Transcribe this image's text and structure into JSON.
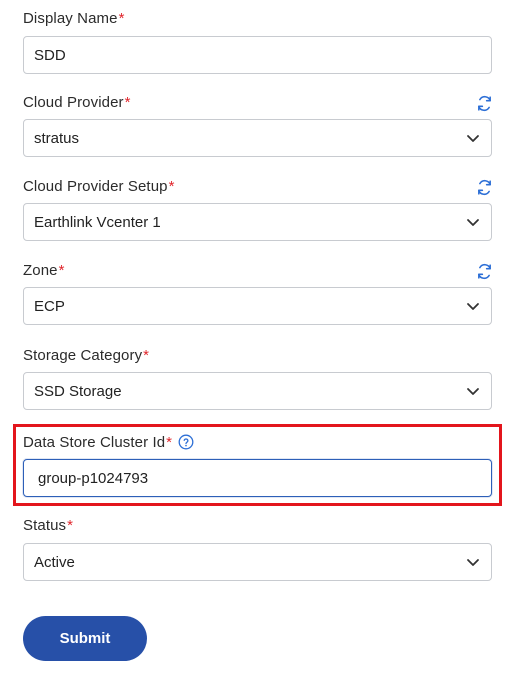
{
  "form": {
    "display_name": {
      "label": "Display Name",
      "required": "*",
      "value": "SDD"
    },
    "cloud_provider": {
      "label": "Cloud Provider",
      "required": "*",
      "value": "stratus"
    },
    "cloud_provider_setup": {
      "label": "Cloud Provider Setup",
      "required": "*",
      "value": "Earthlink Vcenter 1"
    },
    "zone": {
      "label": "Zone",
      "required": "*",
      "value": "ECP"
    },
    "storage_category": {
      "label": "Storage Category",
      "required": "*",
      "value": "SSD Storage"
    },
    "data_store_cluster_id": {
      "label": "Data Store Cluster Id",
      "required": "*",
      "value": "group-p1024793"
    },
    "status": {
      "label": "Status",
      "required": "*",
      "value": "Active"
    },
    "submit_label": "Submit"
  },
  "icons": {
    "refresh": "refresh-icon",
    "chevron": "chevron-down-icon",
    "help": "help-icon"
  },
  "colors": {
    "required": "#e0252b",
    "accent": "#2750a8",
    "refresh": "#2d6fd6",
    "highlight": "#e3151c",
    "border": "#c8cbd0"
  }
}
